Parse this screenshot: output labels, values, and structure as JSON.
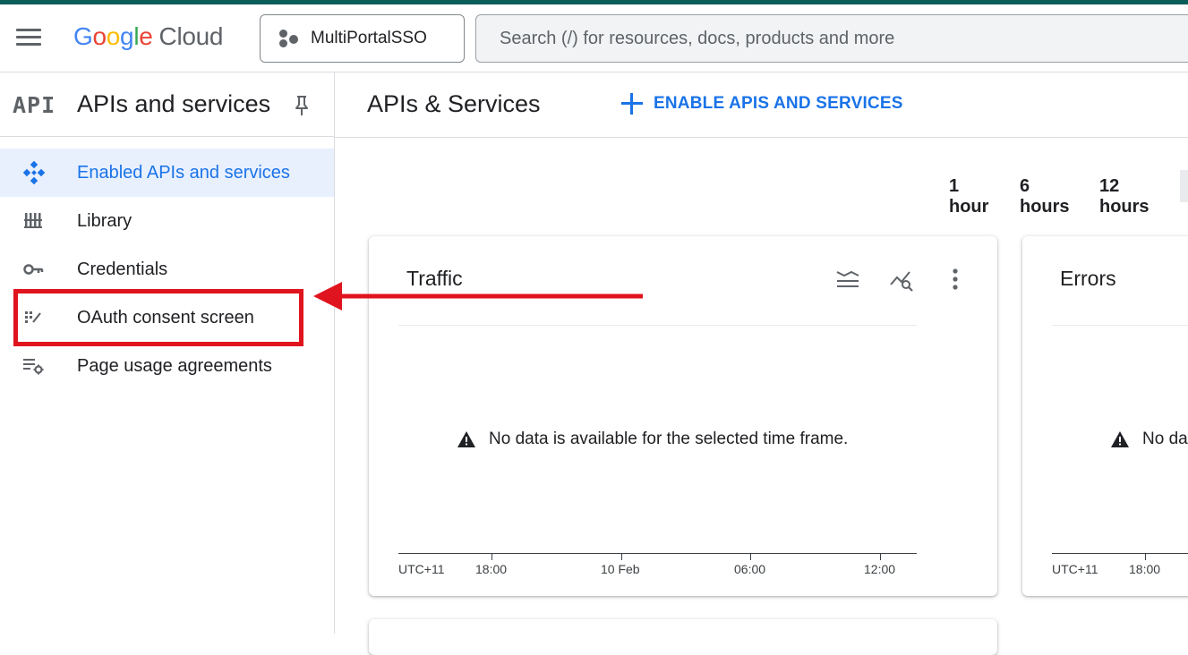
{
  "header": {
    "logo": {
      "google": "Google",
      "cloud": "Cloud"
    },
    "project_label": "MultiPortalSSO",
    "search_placeholder": "Search (/) for resources, docs, products and more"
  },
  "sidebar": {
    "badge": "API",
    "title": "APIs and services",
    "items": [
      {
        "label": "Enabled APIs and services",
        "icon": "diamond-grid-icon",
        "active": true
      },
      {
        "label": "Library",
        "icon": "library-icon",
        "active": false
      },
      {
        "label": "Credentials",
        "icon": "key-icon",
        "active": false
      },
      {
        "label": "OAuth consent screen",
        "icon": "consent-dots-icon",
        "active": false
      },
      {
        "label": "Page usage agreements",
        "icon": "list-settings-icon",
        "active": false
      }
    ]
  },
  "main": {
    "title": "APIs & Services",
    "enable_button": "ENABLE APIS AND SERVICES",
    "time_ranges": [
      "1 hour",
      "6 hours",
      "12 hours"
    ]
  },
  "cards": {
    "traffic": {
      "title": "Traffic",
      "no_data": "No data is available for the selected time frame.",
      "ticks": [
        "UTC+11",
        "18:00",
        "10 Feb",
        "06:00",
        "12:00"
      ]
    },
    "errors": {
      "title": "Errors",
      "no_data": "No da",
      "ticks": [
        "UTC+11",
        "18:00"
      ]
    }
  },
  "colors": {
    "accent": "#1a73e8",
    "active_bg": "#e8f0fe",
    "annotation": "#e0141e"
  }
}
